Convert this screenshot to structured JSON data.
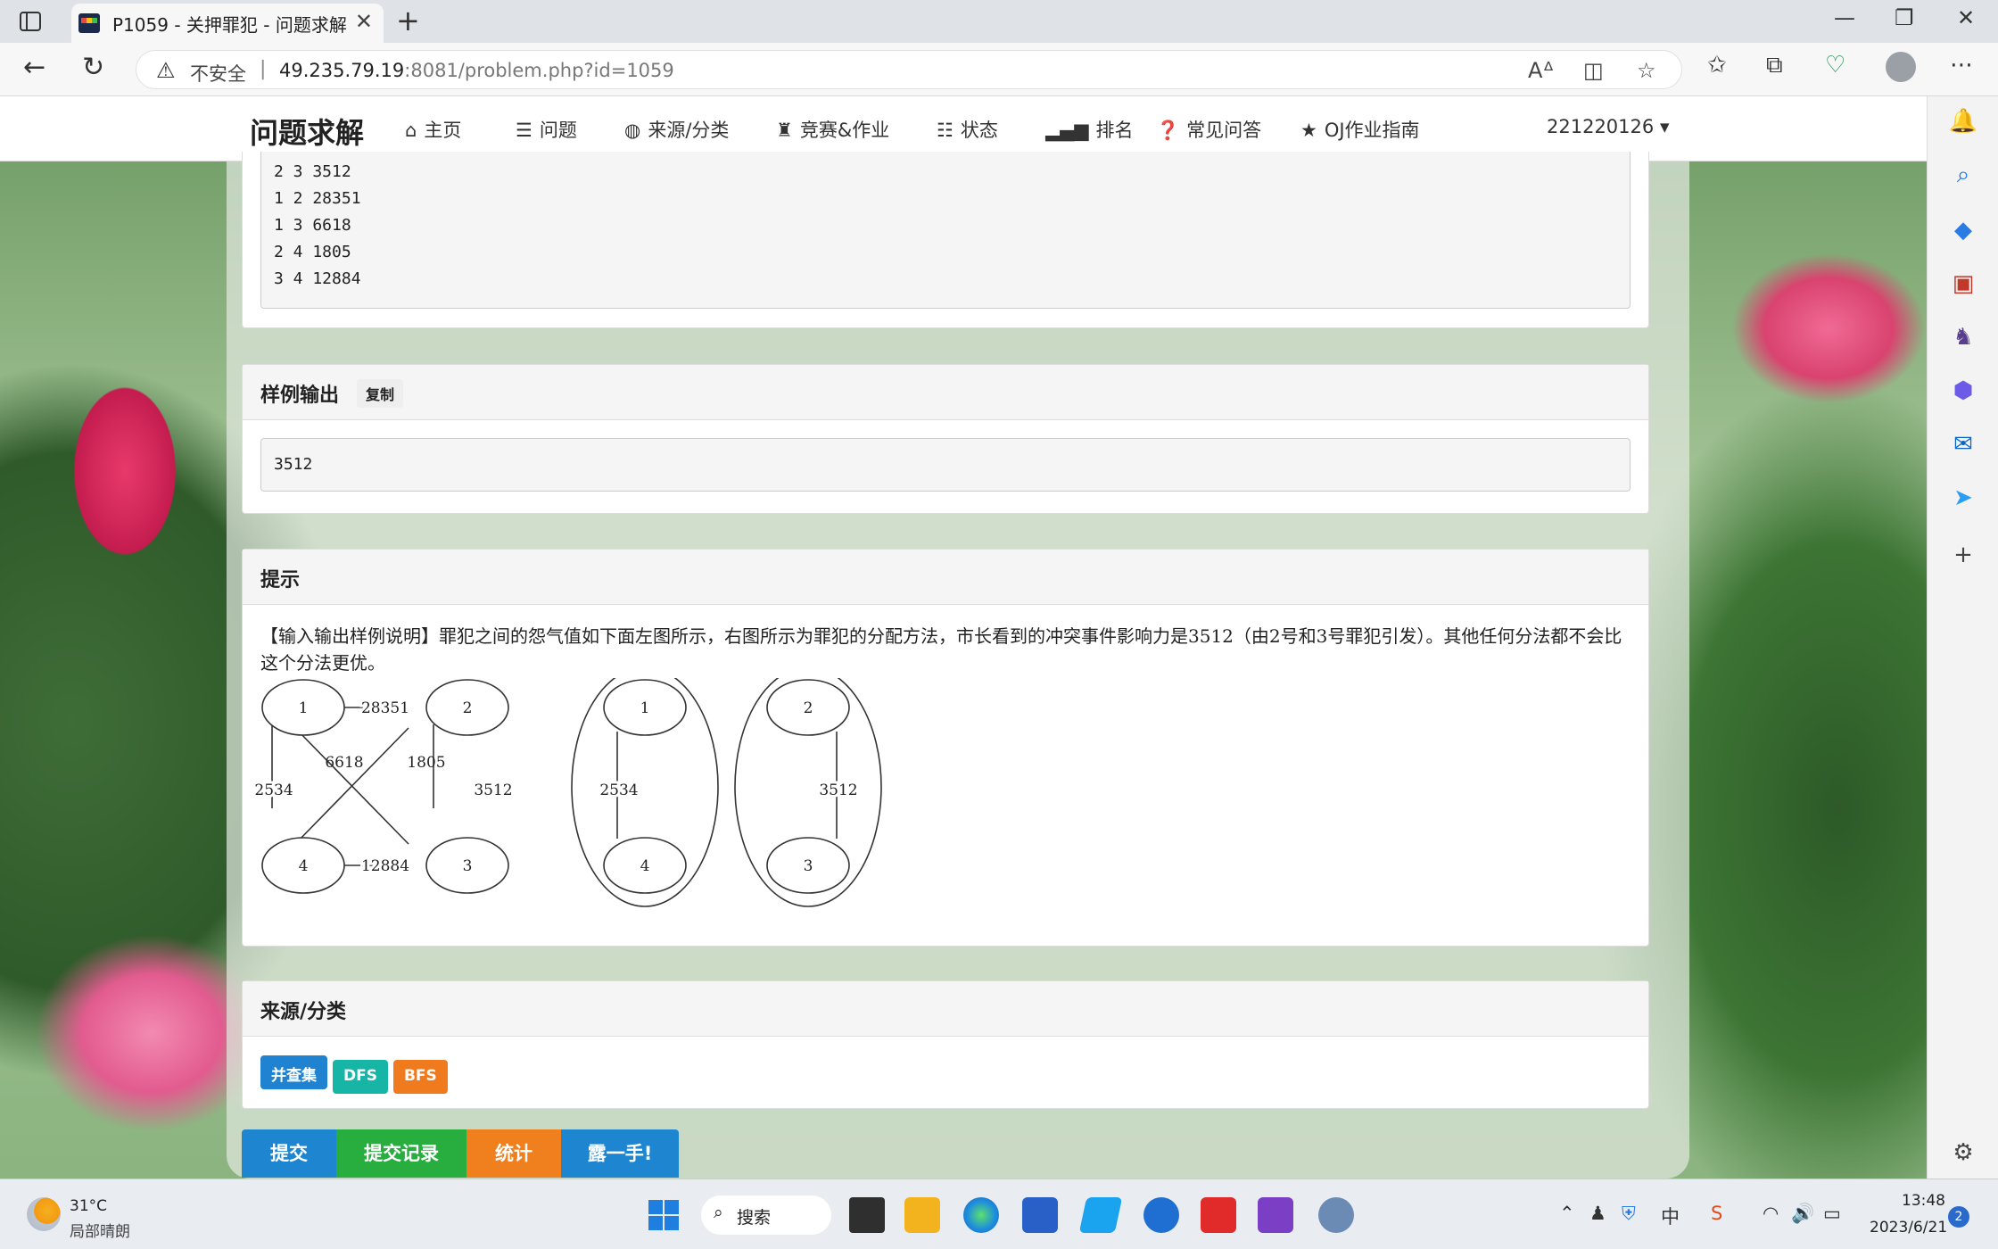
{
  "browser": {
    "tab_title": "P1059 - 关押罪犯 - 问题求解",
    "insecure_label": "不安全",
    "url_host": "49.235.79.19",
    "url_rest": ":8081/problem.php?id=1059"
  },
  "site": {
    "brand": "问题求解",
    "nav": [
      "主页",
      "问题",
      "来源/分类",
      "竞赛&作业",
      "状态",
      "排名",
      "常见问答",
      "OJ作业指南"
    ],
    "user": "221220126"
  },
  "sample_input_tail": "2 3 3512\n1 2 28351\n1 3 6618\n2 4 1805\n3 4 12884",
  "sample_output": {
    "title": "样例输出",
    "copy_label": "复制",
    "value": "3512"
  },
  "hint": {
    "title": "提示",
    "text_1": "【输入输出样例说明】罪犯之间的怨气值如下面左图所示，右图所示为罪犯的分配方法，市长看到的冲突事件影响力是",
    "value": "3512",
    "text_2": "（由",
    "a": "2",
    "text_3": "号和",
    "b": "3",
    "text_4": "号罪犯引发）。其他任何分法都不会比这个分法更优。",
    "figure": {
      "nodes": [
        "1",
        "2",
        "3",
        "4"
      ],
      "edges": [
        "28351",
        "6618",
        "1805",
        "2534",
        "3512",
        "12884"
      ],
      "right_edges": [
        "2534",
        "3512"
      ]
    }
  },
  "source": {
    "title": "来源/分类",
    "tags": [
      {
        "label": "并查集",
        "color": "#1f83d2"
      },
      {
        "label": "DFS",
        "color": "#17b5a6"
      },
      {
        "label": "BFS",
        "color": "#f07a1e"
      }
    ]
  },
  "actions": [
    {
      "label": "提交",
      "color": "#1e86d0"
    },
    {
      "label": "提交记录",
      "color": "#27ae3e"
    },
    {
      "label": "统计",
      "color": "#f0801e"
    },
    {
      "label": "露一手!",
      "color": "#1e86d0"
    }
  ],
  "taskbar": {
    "temp": "31°C",
    "weather": "局部晴朗",
    "search": "搜索",
    "ime": "中",
    "time": "13:48",
    "date": "2023/6/21",
    "notifications": "2"
  },
  "icons": [
    "tab-panel-icon",
    "close-icon",
    "plus-icon",
    "minimize-icon",
    "restore-icon",
    "back-icon",
    "refresh-icon",
    "warning-icon",
    "read-aloud-icon",
    "split-icon",
    "star-icon",
    "favorites-icon",
    "collections-icon",
    "performance-icon",
    "profile-icon",
    "more-icon",
    "home-icon",
    "list-icon",
    "globe-icon",
    "trophy-icon",
    "signal-icon",
    "question-icon",
    "bookmark-star-icon",
    "bell-icon",
    "search-icon",
    "tag-icon",
    "toolbox-icon",
    "chess-icon",
    "copilot-icon",
    "outlook-icon",
    "send-icon",
    "add-icon",
    "settings-icon"
  ]
}
